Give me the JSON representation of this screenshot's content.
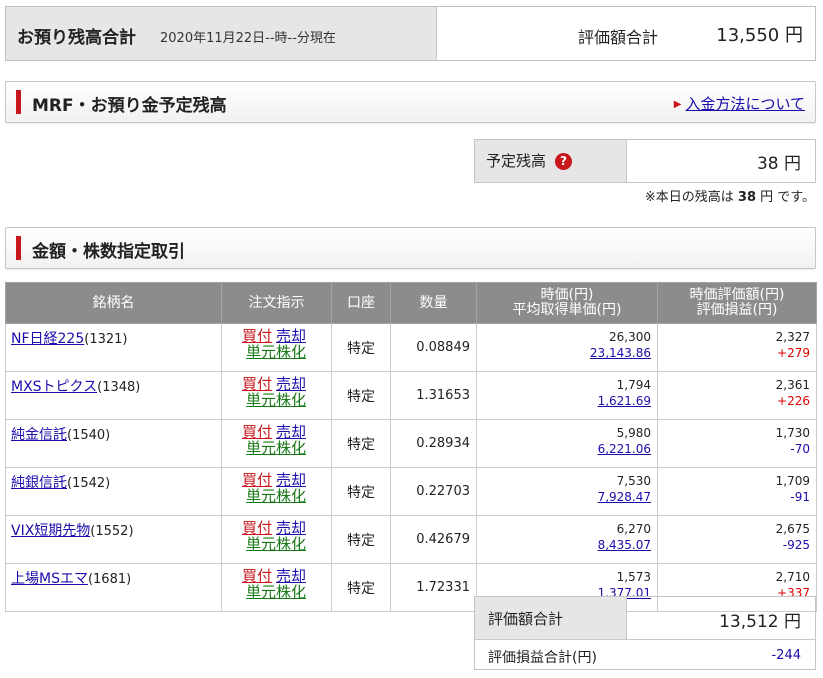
{
  "header": {
    "title": "お預り残高合計",
    "as_of": "2020年11月22日--時--分現在",
    "total_label": "評価額合計",
    "total_value": "13,550 円"
  },
  "mrf": {
    "title": "MRF・お預り金予定残高",
    "link_label": "入金方法について",
    "scheduled_label": "予定残高",
    "scheduled_value": "38 円",
    "today_prefix": "※本日の残高は",
    "today_amount": "38",
    "today_suffix": "円 です。"
  },
  "trade": {
    "title": "金額・株数指定取引"
  },
  "table": {
    "headers": {
      "name": "銘柄名",
      "order": "注文指示",
      "account": "口座",
      "quantity": "数量",
      "price_line1": "時価(円)",
      "price_line2": "平均取得単価(円)",
      "value_line1": "時価評価額(円)",
      "value_line2": "評価損益(円)"
    },
    "actions": {
      "buy": "買付",
      "sell": "売却",
      "tangen": "単元株化"
    },
    "rows": [
      {
        "name": "NF日経225",
        "code": "(1321)",
        "account": "特定",
        "quantity": "0.08849",
        "price": "26,300",
        "cost": "23,143.86",
        "value": "2,327",
        "pl": "+279"
      },
      {
        "name": "MXSトピクス",
        "code": "(1348)",
        "account": "特定",
        "quantity": "1.31653",
        "price": "1,794",
        "cost": "1,621.69",
        "value": "2,361",
        "pl": "+226"
      },
      {
        "name": "純金信託",
        "code": "(1540)",
        "account": "特定",
        "quantity": "0.28934",
        "price": "5,980",
        "cost": "6,221.06",
        "value": "1,730",
        "pl": "-70"
      },
      {
        "name": "純銀信託",
        "code": "(1542)",
        "account": "特定",
        "quantity": "0.22703",
        "price": "7,530",
        "cost": "7,928.47",
        "value": "1,709",
        "pl": "-91"
      },
      {
        "name": "VIX短期先物",
        "code": "(1552)",
        "account": "特定",
        "quantity": "0.42679",
        "price": "6,270",
        "cost": "8,435.07",
        "value": "2,675",
        "pl": "-925"
      },
      {
        "name": "上場MSエマ",
        "code": "(1681)",
        "account": "特定",
        "quantity": "1.72331",
        "price": "1,573",
        "cost": "1,377.01",
        "value": "2,710",
        "pl": "+337"
      }
    ]
  },
  "summary": {
    "total_label": "評価額合計",
    "total_value": "13,512 円",
    "pl_label": "評価損益合計(円)",
    "pl_value": "-244"
  },
  "colors": {
    "accent_red": "#c8161d",
    "link_blue": "#1a0dab",
    "header_gray": "#8c8c8c",
    "label_gray": "#e6e6e6",
    "tangen_green": "#1a7a1a"
  },
  "icons": {
    "help": "question-mark-circle",
    "link_arrow": "triangle-right"
  }
}
